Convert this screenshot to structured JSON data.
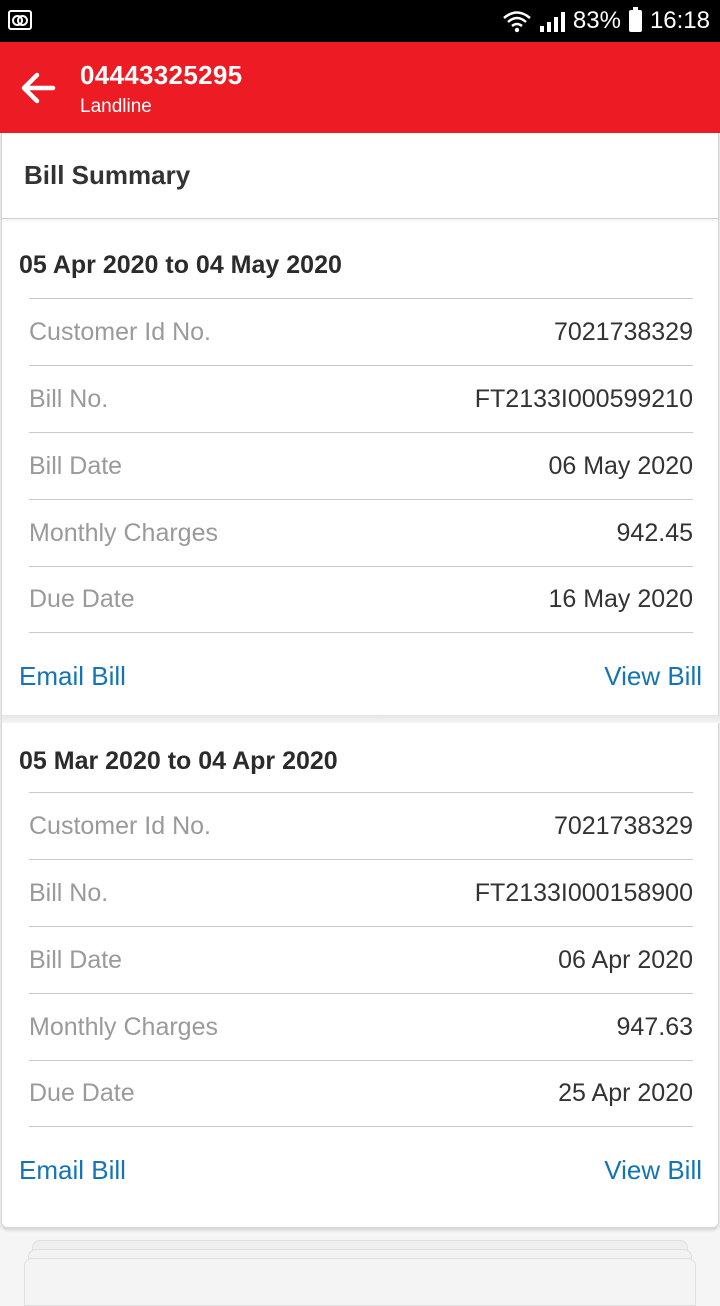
{
  "status_bar": {
    "battery": "83%",
    "time": "16:18",
    "icons": [
      "voicemail-icon",
      "wifi-icon",
      "signal-icon",
      "battery-icon"
    ]
  },
  "app_bar": {
    "title": "04443325295",
    "subtitle": "Landline",
    "back_icon": "arrow-left-icon",
    "color": "#ed1c24"
  },
  "summary": {
    "heading": "Bill Summary"
  },
  "bills": [
    {
      "period": "05 Apr 2020 to 04 May 2020",
      "rows": [
        {
          "label": "Customer Id No.",
          "value": "7021738329"
        },
        {
          "label": "Bill No.",
          "value": "FT2133I000599210"
        },
        {
          "label": "Bill Date",
          "value": "06 May 2020"
        },
        {
          "label": "Monthly Charges",
          "value": "942.45"
        },
        {
          "label": "Due Date",
          "value": "16 May 2020"
        }
      ],
      "email_label": "Email Bill",
      "view_label": "View Bill"
    },
    {
      "period": "05 Mar 2020 to 04 Apr 2020",
      "rows": [
        {
          "label": "Customer Id No.",
          "value": "7021738329"
        },
        {
          "label": "Bill No.",
          "value": "FT2133I000158900"
        },
        {
          "label": "Bill Date",
          "value": "06 Apr 2020"
        },
        {
          "label": "Monthly Charges",
          "value": "947.63"
        },
        {
          "label": "Due Date",
          "value": "25 Apr 2020"
        }
      ],
      "email_label": "Email Bill",
      "view_label": "View Bill"
    }
  ],
  "link_color": "#1574b6"
}
